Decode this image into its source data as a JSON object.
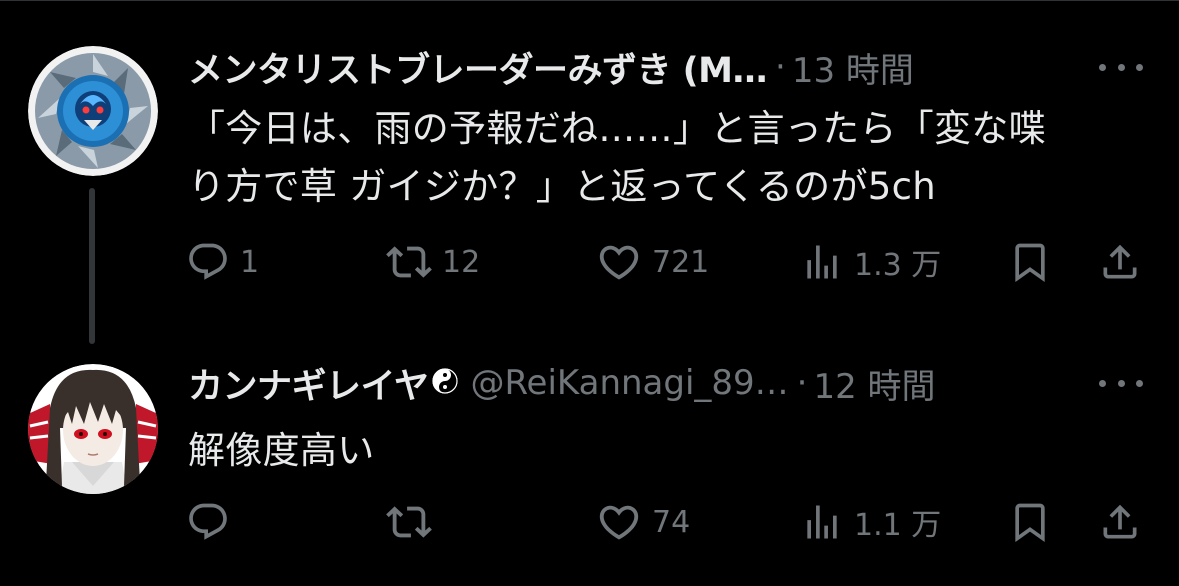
{
  "posts": [
    {
      "display_name": "メンタリストブレーダーみずき (M…",
      "separator": "·",
      "time": "13 時間",
      "text_lines": [
        "「今日は、雨の予報だね……」と言ったら「変な喋",
        "り方で草 ガイジか？」と返ってくるのが5ch"
      ],
      "avatar_icon": "beyblade-avatar",
      "metrics": {
        "replies": "1",
        "retweets": "12",
        "likes": "721",
        "views": "1.3 万"
      }
    },
    {
      "display_name": "カンナギレイヤ",
      "emoji": "☯",
      "handle": "@ReiKannagi_89…",
      "separator": "·",
      "time": "12 時間",
      "text_lines": [
        "解像度高い"
      ],
      "avatar_icon": "anime-character-avatar",
      "metrics": {
        "replies": "",
        "retweets": "",
        "likes": "74",
        "views": "1.1 万"
      }
    }
  ],
  "colors": {
    "background": "#000000",
    "text_primary": "#e7e9ea",
    "text_secondary": "#71767b",
    "thread_line": "#333639"
  },
  "icons": [
    "reply-icon",
    "retweet-icon",
    "like-icon",
    "views-icon",
    "bookmark-icon",
    "share-icon",
    "more-icon"
  ]
}
